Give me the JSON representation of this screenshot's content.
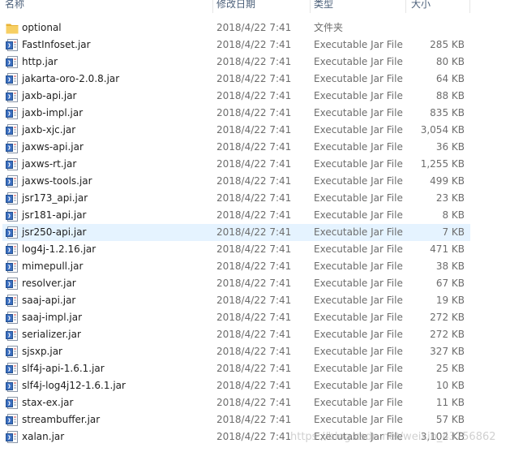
{
  "columns": {
    "name": "名称",
    "date": "修改日期",
    "type": "类型",
    "size": "大小"
  },
  "files": [
    {
      "name": "optional",
      "date": "2018/4/22 7:41",
      "type": "文件夹",
      "size": "",
      "icon": "folder-icon"
    },
    {
      "name": "FastInfoset.jar",
      "date": "2018/4/22 7:41",
      "type": "Executable Jar File",
      "size": "285 KB",
      "icon": "jar-icon"
    },
    {
      "name": "http.jar",
      "date": "2018/4/22 7:41",
      "type": "Executable Jar File",
      "size": "80 KB",
      "icon": "jar-icon"
    },
    {
      "name": "jakarta-oro-2.0.8.jar",
      "date": "2018/4/22 7:41",
      "type": "Executable Jar File",
      "size": "64 KB",
      "icon": "jar-icon"
    },
    {
      "name": "jaxb-api.jar",
      "date": "2018/4/22 7:41",
      "type": "Executable Jar File",
      "size": "88 KB",
      "icon": "jar-icon"
    },
    {
      "name": "jaxb-impl.jar",
      "date": "2018/4/22 7:41",
      "type": "Executable Jar File",
      "size": "835 KB",
      "icon": "jar-icon"
    },
    {
      "name": "jaxb-xjc.jar",
      "date": "2018/4/22 7:41",
      "type": "Executable Jar File",
      "size": "3,054 KB",
      "icon": "jar-icon"
    },
    {
      "name": "jaxws-api.jar",
      "date": "2018/4/22 7:41",
      "type": "Executable Jar File",
      "size": "36 KB",
      "icon": "jar-icon"
    },
    {
      "name": "jaxws-rt.jar",
      "date": "2018/4/22 7:41",
      "type": "Executable Jar File",
      "size": "1,255 KB",
      "icon": "jar-icon"
    },
    {
      "name": "jaxws-tools.jar",
      "date": "2018/4/22 7:41",
      "type": "Executable Jar File",
      "size": "499 KB",
      "icon": "jar-icon"
    },
    {
      "name": "jsr173_api.jar",
      "date": "2018/4/22 7:41",
      "type": "Executable Jar File",
      "size": "23 KB",
      "icon": "jar-icon"
    },
    {
      "name": "jsr181-api.jar",
      "date": "2018/4/22 7:41",
      "type": "Executable Jar File",
      "size": "8 KB",
      "icon": "jar-icon"
    },
    {
      "name": "jsr250-api.jar",
      "date": "2018/4/22 7:41",
      "type": "Executable Jar File",
      "size": "7 KB",
      "icon": "jar-icon",
      "selected": true
    },
    {
      "name": "log4j-1.2.16.jar",
      "date": "2018/4/22 7:41",
      "type": "Executable Jar File",
      "size": "471 KB",
      "icon": "jar-icon"
    },
    {
      "name": "mimepull.jar",
      "date": "2018/4/22 7:41",
      "type": "Executable Jar File",
      "size": "38 KB",
      "icon": "jar-icon"
    },
    {
      "name": "resolver.jar",
      "date": "2018/4/22 7:41",
      "type": "Executable Jar File",
      "size": "67 KB",
      "icon": "jar-icon"
    },
    {
      "name": "saaj-api.jar",
      "date": "2018/4/22 7:41",
      "type": "Executable Jar File",
      "size": "19 KB",
      "icon": "jar-icon"
    },
    {
      "name": "saaj-impl.jar",
      "date": "2018/4/22 7:41",
      "type": "Executable Jar File",
      "size": "272 KB",
      "icon": "jar-icon"
    },
    {
      "name": "serializer.jar",
      "date": "2018/4/22 7:41",
      "type": "Executable Jar File",
      "size": "272 KB",
      "icon": "jar-icon"
    },
    {
      "name": "sjsxp.jar",
      "date": "2018/4/22 7:41",
      "type": "Executable Jar File",
      "size": "327 KB",
      "icon": "jar-icon"
    },
    {
      "name": "slf4j-api-1.6.1.jar",
      "date": "2018/4/22 7:41",
      "type": "Executable Jar File",
      "size": "25 KB",
      "icon": "jar-icon"
    },
    {
      "name": "slf4j-log4j12-1.6.1.jar",
      "date": "2018/4/22 7:41",
      "type": "Executable Jar File",
      "size": "10 KB",
      "icon": "jar-icon"
    },
    {
      "name": "stax-ex.jar",
      "date": "2018/4/22 7:41",
      "type": "Executable Jar File",
      "size": "11 KB",
      "icon": "jar-icon"
    },
    {
      "name": "streambuffer.jar",
      "date": "2018/4/22 7:41",
      "type": "Executable Jar File",
      "size": "57 KB",
      "icon": "jar-icon"
    },
    {
      "name": "xalan.jar",
      "date": "2018/4/22 7:41",
      "type": "Executable Jar File",
      "size": "3,102 KB",
      "icon": "jar-icon"
    }
  ],
  "watermark": "https://blog.csdn.net/weixin_43756862",
  "colors": {
    "selection": "#e5f3ff",
    "header_text": "#4c607a",
    "secondary_text": "#6d6d6d",
    "folder": "#f3c75a",
    "jar_accent": "#3b6fc1"
  }
}
